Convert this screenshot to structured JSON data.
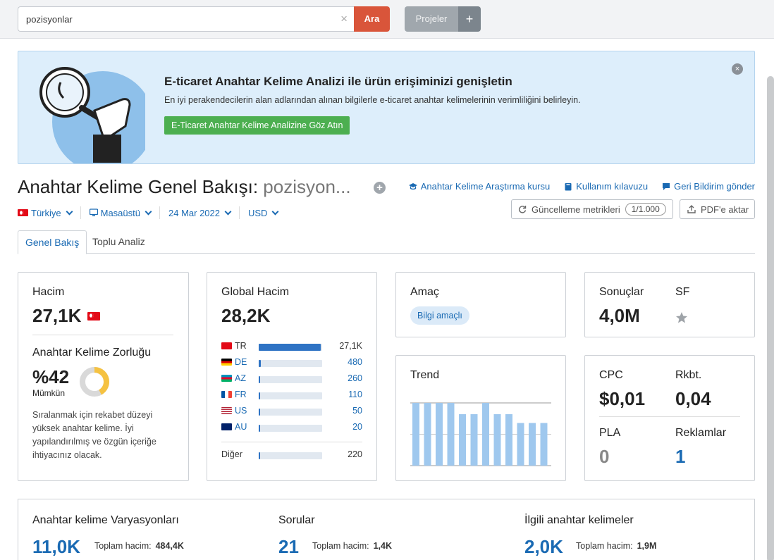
{
  "search": {
    "value": "pozisyonlar",
    "clear": "×",
    "button": "Ara"
  },
  "projects": {
    "label": "Projeler",
    "add": "+"
  },
  "banner": {
    "title": "E-ticaret Anahtar Kelime Analizi ile ürün erişiminizi genişletin",
    "text": "En iyi perakendecilerin alan adlarından alınan bilgilerle e-ticaret anahtar kelimelerinin verimliliğini belirleyin.",
    "cta": "E-Ticaret Anahtar Kelime Analizine Göz Atın",
    "close": "×"
  },
  "header": {
    "title_prefix": "Anahtar Kelime Genel Bakışı:",
    "keyword": "pozisyon...",
    "plus": "+",
    "links": {
      "course": "Anahtar Kelime Araştırma kursu",
      "guide": "Kullanım kılavuzu",
      "feedback": "Geri Bildirim gönder"
    }
  },
  "filters": {
    "country": "Türkiye",
    "device": "Masaüstü",
    "date": "24 Mar 2022",
    "currency": "USD"
  },
  "actions": {
    "update": "Güncelleme metrikleri",
    "update_count": "1/1.000",
    "pdf": "PDF'e aktar"
  },
  "tabs": {
    "overview": "Genel Bakış",
    "bulk": "Toplu Analiz"
  },
  "volume": {
    "label": "Hacim",
    "value": "27,1K"
  },
  "difficulty": {
    "label": "Anahtar Kelime Zorluğu",
    "value": "%42",
    "level": "Mümkün",
    "percent": 42,
    "description": "Sıralanmak için rekabet düzeyi yüksek anahtar kelime. İyi yapılandırılmış ve özgün içeriğe ihtiyacınız olacak."
  },
  "global_volume": {
    "label": "Global Hacim",
    "value": "28,2K",
    "rows": [
      {
        "cc": "TR",
        "value": "27,1K",
        "share": 1.0,
        "flag": "tr"
      },
      {
        "cc": "DE",
        "value": "480",
        "share": 0.03,
        "flag": "de"
      },
      {
        "cc": "AZ",
        "value": "260",
        "share": 0.02,
        "flag": "az"
      },
      {
        "cc": "FR",
        "value": "110",
        "share": 0.02,
        "flag": "fr"
      },
      {
        "cc": "US",
        "value": "50",
        "share": 0.02,
        "flag": "us"
      },
      {
        "cc": "AU",
        "value": "20",
        "share": 0.02,
        "flag": "au"
      }
    ],
    "other": {
      "label": "Diğer",
      "value": "220",
      "share": 0.02
    }
  },
  "intent": {
    "label": "Amaç",
    "badge": "Bilgi amaçlı"
  },
  "results": {
    "label": "Sonuçlar",
    "value": "4,0M",
    "sf_label": "SF",
    "sf_icon": "star-icon"
  },
  "trend": {
    "label": "Trend",
    "values": [
      1.0,
      1.0,
      1.0,
      1.0,
      0.82,
      0.82,
      1.0,
      0.82,
      0.82,
      0.68,
      0.68,
      0.68
    ]
  },
  "cpc": {
    "cpc_label": "CPC",
    "cpc_value": "$0,01",
    "comp_label": "Rkbt.",
    "comp_value": "0,04",
    "pla_label": "PLA",
    "pla_value": "0",
    "ads_label": "Reklamlar",
    "ads_value": "1"
  },
  "bottom": {
    "variations": {
      "title": "Anahtar kelime Varyasyonları",
      "value": "11,0K",
      "sub_label": "Toplam hacim:",
      "sub_value": "484,4K"
    },
    "questions": {
      "title": "Sorular",
      "value": "21",
      "sub_label": "Toplam hacim:",
      "sub_value": "1,4K"
    },
    "related": {
      "title": "İlgili anahtar kelimeler",
      "value": "2,0K",
      "sub_label": "Toplam hacim:",
      "sub_value": "1,9M"
    }
  },
  "colors": {
    "accent": "#1a6ab3",
    "search_button": "#d9553a",
    "cta": "#4caf50",
    "bar": "#2e73c4",
    "trend_bar": "#9fc8ee",
    "donut": "#f5c242"
  }
}
